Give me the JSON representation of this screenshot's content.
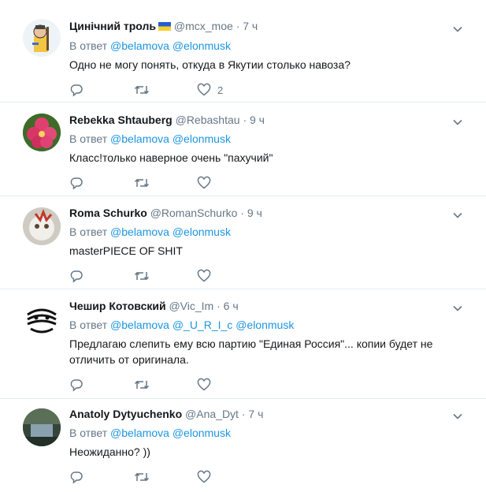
{
  "reply_label": "В ответ",
  "tweets": [
    {
      "name": "Цинічний троль",
      "handle": "@mcx_moe",
      "time": "7 ч",
      "mentions": [
        "@belamova",
        "@elonmusk"
      ],
      "text": "Одно не могу понять, откуда в Якутии столько навоза?",
      "like_count": "2"
    },
    {
      "name": "Rebekka Shtauberg",
      "handle": "@Rebashtau",
      "time": "9 ч",
      "mentions": [
        "@belamova",
        "@elonmusk"
      ],
      "text": "Класс!только наверное очень \"пахучий\""
    },
    {
      "name": "Roma Schurko",
      "handle": "@RomanSchurko",
      "time": "9 ч",
      "mentions": [
        "@belamova",
        "@elonmusk"
      ],
      "text": "masterPIECE OF SHIT"
    },
    {
      "name": "Чешир Котовский",
      "handle": "@Vic_Im",
      "time": "6 ч",
      "mentions": [
        "@belamova",
        "@_U_R_I_c",
        "@elonmusk"
      ],
      "text_lines": [
        "Предлагаю слепить ему всю партию \"Единая Россия\"... копии будет не",
        "отличить от оригинала."
      ]
    },
    {
      "name": "Anatoly Dytyuchenko",
      "handle": "@Ana_Dyt",
      "time": "7 ч",
      "mentions": [
        "@belamova",
        "@elonmusk"
      ],
      "text": "Неожиданно? ))"
    }
  ]
}
